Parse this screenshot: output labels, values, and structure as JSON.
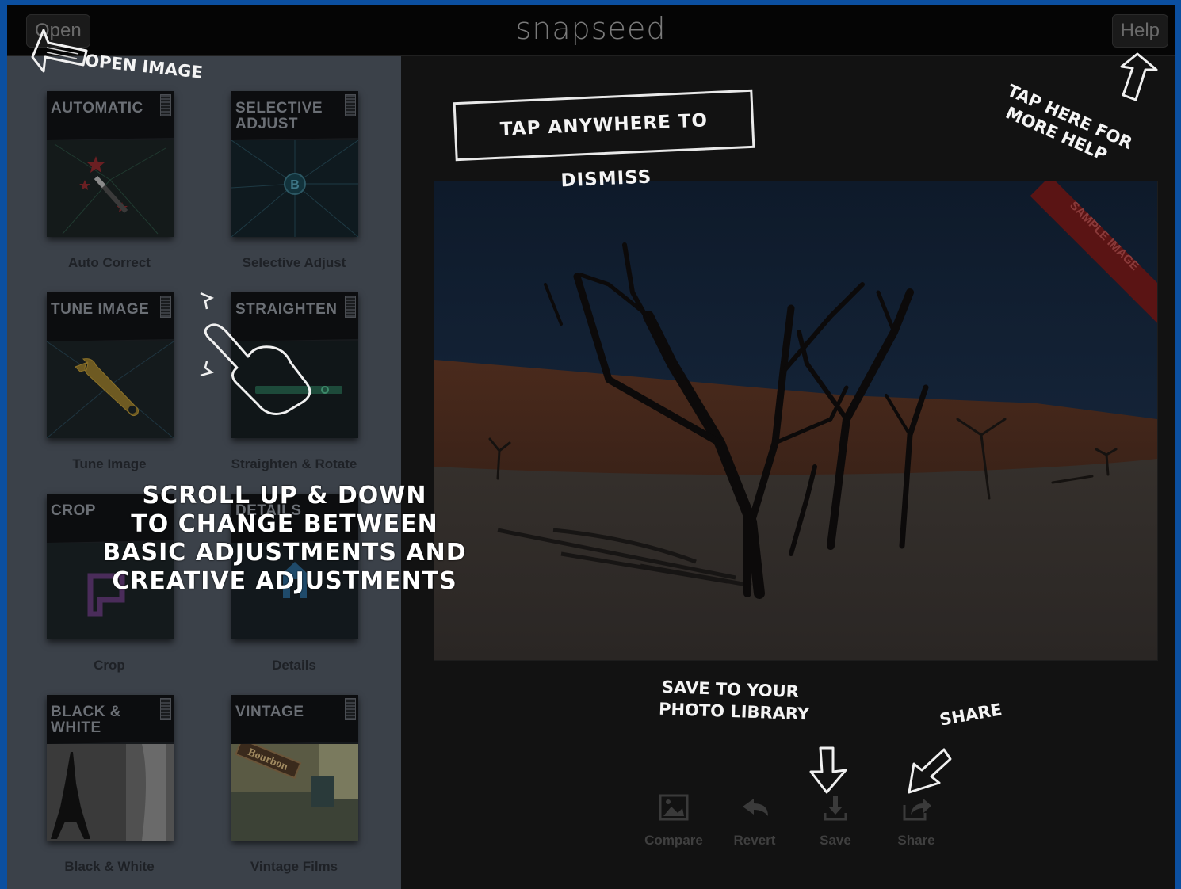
{
  "topbar": {
    "open_label": "Open",
    "title": "snapseed",
    "help_label": "Help"
  },
  "tools": [
    {
      "title": "AUTOMATIC",
      "label": "Auto Correct",
      "icon": "auto-correct-wand-icon"
    },
    {
      "title": "SELECTIVE ADJUST",
      "label": "Selective Adjust",
      "icon": "selective-point-icon",
      "point_letter": "B"
    },
    {
      "title": "TUNE IMAGE",
      "label": "Tune Image",
      "icon": "wrench-icon"
    },
    {
      "title": "STRAIGHTEN",
      "label": "Straighten & Rotate",
      "icon": "straighten-icon"
    },
    {
      "title": "CROP",
      "label": "Crop",
      "icon": "crop-icon"
    },
    {
      "title": "DETAILS",
      "label": "Details",
      "icon": "details-icon"
    },
    {
      "title": "BLACK & WHITE",
      "label": "Black & White",
      "icon": "eiffel-tower-icon"
    },
    {
      "title": "VINTAGE",
      "label": "Vintage Films",
      "icon": "vintage-sign-icon",
      "sign_text": "Bourbon"
    }
  ],
  "photo": {
    "ribbon": "SAMPLE IMAGE"
  },
  "actions": [
    {
      "label": "Compare",
      "icon": "compare-image-icon"
    },
    {
      "label": "Revert",
      "icon": "revert-arrow-icon"
    },
    {
      "label": "Save",
      "icon": "save-download-icon"
    },
    {
      "label": "Share",
      "icon": "share-export-icon"
    }
  ],
  "overlay": {
    "open_image": "OPEN IMAGE",
    "dismiss": "TAP ANYWHERE TO DISMISS",
    "help_line1": "TAP HERE FOR",
    "help_line2": "MORE HELP",
    "scroll_lines": [
      "SCROLL UP & DOWN",
      "TO CHANGE BETWEEN",
      "BASIC ADJUSTMENTS AND",
      "CREATIVE ADJUSTMENTS"
    ],
    "save_line1": "SAVE TO YOUR",
    "save_line2": "PHOTO LIBRARY",
    "share": "SHARE"
  },
  "colors": {
    "frame": "#0b4fa0",
    "sidebar": "#3b4149",
    "main_bg": "#121212",
    "ribbon": "#8a1a1a",
    "annotation": "#f4f4f4"
  }
}
